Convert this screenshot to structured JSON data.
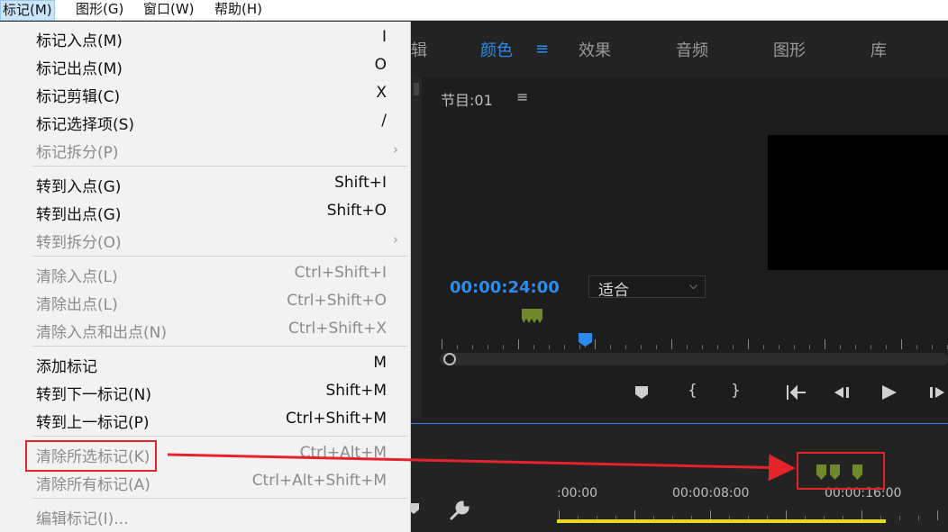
{
  "menubar": {
    "items": [
      "标记(M)",
      "图形(G)",
      "窗口(W)",
      "帮助(H)"
    ]
  },
  "workspace": {
    "tabs": [
      "颜色",
      "效果",
      "音频",
      "图形",
      "库"
    ],
    "partial_tab": "辑"
  },
  "program_monitor": {
    "title": "节目:01",
    "timecode": "00:00:24:00",
    "fit_option": "适合"
  },
  "timeline": {
    "timecodes": [
      ":00:00",
      "00:00:08:00",
      "00:00:16:00"
    ]
  },
  "menu": {
    "items": [
      {
        "label": "标记入点(M)",
        "accel": "I"
      },
      {
        "label": "标记出点(M)",
        "accel": "O"
      },
      {
        "label": "标记剪辑(C)",
        "accel": "X"
      },
      {
        "label": "标记选择项(S)",
        "accel": "/"
      },
      {
        "label": "标记拆分(P)",
        "accel": ""
      },
      {
        "label": "转到入点(G)",
        "accel": "Shift+I"
      },
      {
        "label": "转到出点(G)",
        "accel": "Shift+O"
      },
      {
        "label": "转到拆分(O)",
        "accel": ""
      },
      {
        "label": "清除入点(L)",
        "accel": "Ctrl+Shift+I"
      },
      {
        "label": "清除出点(L)",
        "accel": "Ctrl+Shift+O"
      },
      {
        "label": "清除入点和出点(N)",
        "accel": "Ctrl+Shift+X"
      },
      {
        "label": "添加标记",
        "accel": "M"
      },
      {
        "label": "转到下一标记(N)",
        "accel": "Shift+M"
      },
      {
        "label": "转到上一标记(P)",
        "accel": "Ctrl+Shift+M"
      },
      {
        "label": "清除所选标记(K)",
        "accel": "Ctrl+Alt+M"
      },
      {
        "label": "清除所有标记(A)",
        "accel": "Ctrl+Alt+Shift+M"
      },
      {
        "label": "编辑标记(I)...",
        "accel": ""
      }
    ]
  },
  "colors": {
    "accent_blue": "#2d8ceb",
    "marker_green": "#6e8a2c",
    "annotation_red": "#e3242b",
    "work_area_yellow": "#e8dc18"
  }
}
